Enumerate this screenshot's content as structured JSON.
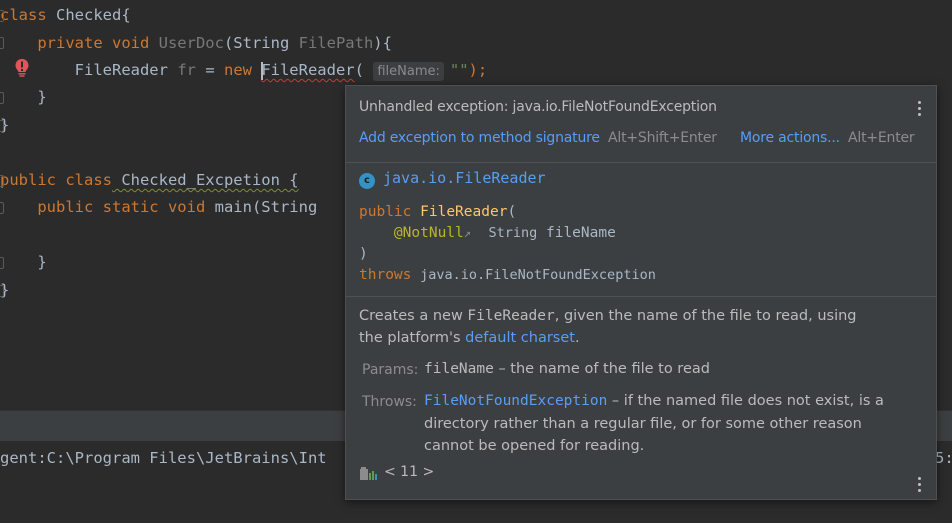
{
  "editor": {
    "lines": [
      {
        "kw": "class",
        "rest": " Checked{"
      },
      {
        "indent": "    ",
        "kw": "private void",
        "name": " UserDoc",
        "rest": "(String ",
        "param": "FilePath",
        "tail": "){"
      },
      {
        "indent": "        ",
        "type": "FileReader",
        "var": " fr",
        "eq": " = ",
        "new": "new ",
        "ctor": "FileReader",
        "open": "(",
        "hint": "fileName:",
        "arg": "\"\"",
        "close": ");"
      },
      {
        "text": "    }"
      },
      {
        "text": "}"
      },
      {
        "kw": "public class",
        "rest": " Checked_Excpetion {"
      },
      {
        "indent": "    ",
        "kw": "public static void",
        "rest": " main(String"
      },
      {
        "text": "    }"
      },
      {
        "text": "}"
      }
    ]
  },
  "console": {
    "text": "gent:C:\\Program Files\\JetBrains\\Int",
    "right_text": "5:"
  },
  "popup": {
    "error_title": "Unhandled exception: java.io.FileNotFoundException",
    "action_primary": "Add exception to method signature",
    "action_primary_shortcut": "Alt+Shift+Enter",
    "action_more": "More actions...",
    "action_more_shortcut": "Alt+Enter",
    "class_badge": "c",
    "class_name": "java.io.FileReader",
    "sig_public": "public",
    "sig_ctor": "FileReader",
    "sig_open": "(",
    "sig_annotation": "@NotNull",
    "sig_annotation_arrow": "↗",
    "sig_param_type": "String",
    "sig_param_name": "fileName",
    "sig_close": ")",
    "sig_throws": "throws",
    "sig_exception": "java.io.FileNotFoundException",
    "desc_pre": "Creates a new ",
    "desc_code": "FileReader",
    "desc_mid": ", given the name of the file to read, using the platform's ",
    "desc_link": "default charset",
    "desc_end": ".",
    "params_label": "Params:",
    "param_name": "fileName",
    "param_desc": " – the name of the file to read",
    "throws_label": "Throws:",
    "throws_name": "FileNotFoundException",
    "throws_desc": " – if the named file does not exist, is a directory rather than a regular file, or for some other reason cannot be opened for reading.",
    "footer_nav": "< 11 >"
  },
  "colors": {
    "keyword": "#cc7832",
    "link": "#589df6",
    "function": "#ffc66d",
    "annotation": "#bbb529",
    "error_red": "#bc3f3c"
  }
}
